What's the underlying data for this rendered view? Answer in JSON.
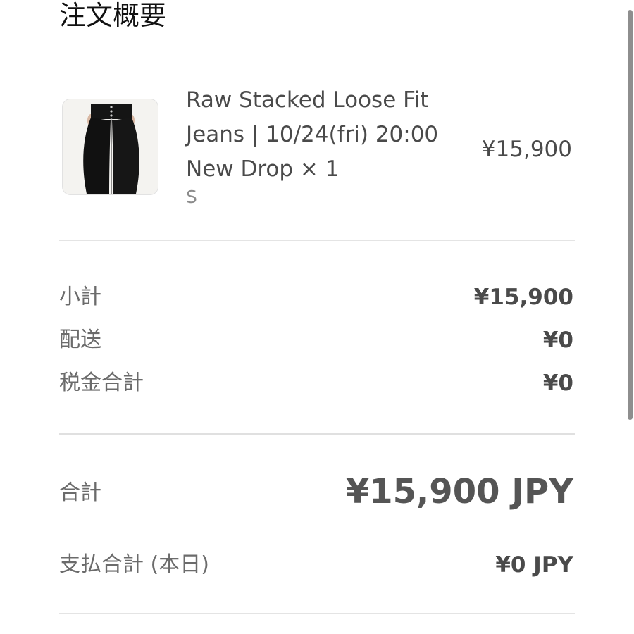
{
  "title": "注文概要",
  "product": {
    "name": "Raw Stacked Loose Fit Jeans | 10/24(fri) 20:00 New Drop × 1",
    "variant": "S",
    "price": "¥15,900"
  },
  "summary": {
    "subtotal_label": "小計",
    "subtotal_value": "¥15,900",
    "shipping_label": "配送",
    "shipping_value": "¥0",
    "tax_label": "税金合計",
    "tax_value": "¥0"
  },
  "total": {
    "label": "合計",
    "value": "¥15,900 JPY"
  },
  "due_today": {
    "label": "支払合計 (本日)",
    "value": "¥0 JPY"
  },
  "icons": {
    "thumbnail": "black-jeans-photo"
  }
}
